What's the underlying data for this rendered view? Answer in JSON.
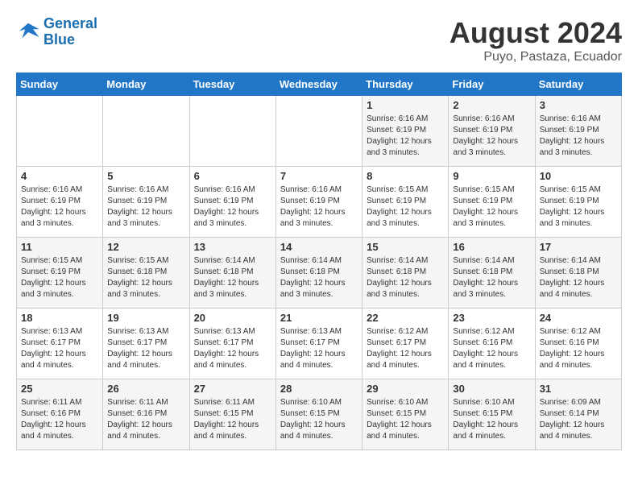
{
  "header": {
    "logo_line1": "General",
    "logo_line2": "Blue",
    "title": "August 2024",
    "subtitle": "Puyo, Pastaza, Ecuador"
  },
  "days_of_week": [
    "Sunday",
    "Monday",
    "Tuesday",
    "Wednesday",
    "Thursday",
    "Friday",
    "Saturday"
  ],
  "weeks": [
    [
      {
        "day": "",
        "info": ""
      },
      {
        "day": "",
        "info": ""
      },
      {
        "day": "",
        "info": ""
      },
      {
        "day": "",
        "info": ""
      },
      {
        "day": "1",
        "info": "Sunrise: 6:16 AM\nSunset: 6:19 PM\nDaylight: 12 hours\nand 3 minutes."
      },
      {
        "day": "2",
        "info": "Sunrise: 6:16 AM\nSunset: 6:19 PM\nDaylight: 12 hours\nand 3 minutes."
      },
      {
        "day": "3",
        "info": "Sunrise: 6:16 AM\nSunset: 6:19 PM\nDaylight: 12 hours\nand 3 minutes."
      }
    ],
    [
      {
        "day": "4",
        "info": "Sunrise: 6:16 AM\nSunset: 6:19 PM\nDaylight: 12 hours\nand 3 minutes."
      },
      {
        "day": "5",
        "info": "Sunrise: 6:16 AM\nSunset: 6:19 PM\nDaylight: 12 hours\nand 3 minutes."
      },
      {
        "day": "6",
        "info": "Sunrise: 6:16 AM\nSunset: 6:19 PM\nDaylight: 12 hours\nand 3 minutes."
      },
      {
        "day": "7",
        "info": "Sunrise: 6:16 AM\nSunset: 6:19 PM\nDaylight: 12 hours\nand 3 minutes."
      },
      {
        "day": "8",
        "info": "Sunrise: 6:15 AM\nSunset: 6:19 PM\nDaylight: 12 hours\nand 3 minutes."
      },
      {
        "day": "9",
        "info": "Sunrise: 6:15 AM\nSunset: 6:19 PM\nDaylight: 12 hours\nand 3 minutes."
      },
      {
        "day": "10",
        "info": "Sunrise: 6:15 AM\nSunset: 6:19 PM\nDaylight: 12 hours\nand 3 minutes."
      }
    ],
    [
      {
        "day": "11",
        "info": "Sunrise: 6:15 AM\nSunset: 6:19 PM\nDaylight: 12 hours\nand 3 minutes."
      },
      {
        "day": "12",
        "info": "Sunrise: 6:15 AM\nSunset: 6:18 PM\nDaylight: 12 hours\nand 3 minutes."
      },
      {
        "day": "13",
        "info": "Sunrise: 6:14 AM\nSunset: 6:18 PM\nDaylight: 12 hours\nand 3 minutes."
      },
      {
        "day": "14",
        "info": "Sunrise: 6:14 AM\nSunset: 6:18 PM\nDaylight: 12 hours\nand 3 minutes."
      },
      {
        "day": "15",
        "info": "Sunrise: 6:14 AM\nSunset: 6:18 PM\nDaylight: 12 hours\nand 3 minutes."
      },
      {
        "day": "16",
        "info": "Sunrise: 6:14 AM\nSunset: 6:18 PM\nDaylight: 12 hours\nand 3 minutes."
      },
      {
        "day": "17",
        "info": "Sunrise: 6:14 AM\nSunset: 6:18 PM\nDaylight: 12 hours\nand 4 minutes."
      }
    ],
    [
      {
        "day": "18",
        "info": "Sunrise: 6:13 AM\nSunset: 6:17 PM\nDaylight: 12 hours\nand 4 minutes."
      },
      {
        "day": "19",
        "info": "Sunrise: 6:13 AM\nSunset: 6:17 PM\nDaylight: 12 hours\nand 4 minutes."
      },
      {
        "day": "20",
        "info": "Sunrise: 6:13 AM\nSunset: 6:17 PM\nDaylight: 12 hours\nand 4 minutes."
      },
      {
        "day": "21",
        "info": "Sunrise: 6:13 AM\nSunset: 6:17 PM\nDaylight: 12 hours\nand 4 minutes."
      },
      {
        "day": "22",
        "info": "Sunrise: 6:12 AM\nSunset: 6:17 PM\nDaylight: 12 hours\nand 4 minutes."
      },
      {
        "day": "23",
        "info": "Sunrise: 6:12 AM\nSunset: 6:16 PM\nDaylight: 12 hours\nand 4 minutes."
      },
      {
        "day": "24",
        "info": "Sunrise: 6:12 AM\nSunset: 6:16 PM\nDaylight: 12 hours\nand 4 minutes."
      }
    ],
    [
      {
        "day": "25",
        "info": "Sunrise: 6:11 AM\nSunset: 6:16 PM\nDaylight: 12 hours\nand 4 minutes."
      },
      {
        "day": "26",
        "info": "Sunrise: 6:11 AM\nSunset: 6:16 PM\nDaylight: 12 hours\nand 4 minutes."
      },
      {
        "day": "27",
        "info": "Sunrise: 6:11 AM\nSunset: 6:15 PM\nDaylight: 12 hours\nand 4 minutes."
      },
      {
        "day": "28",
        "info": "Sunrise: 6:10 AM\nSunset: 6:15 PM\nDaylight: 12 hours\nand 4 minutes."
      },
      {
        "day": "29",
        "info": "Sunrise: 6:10 AM\nSunset: 6:15 PM\nDaylight: 12 hours\nand 4 minutes."
      },
      {
        "day": "30",
        "info": "Sunrise: 6:10 AM\nSunset: 6:15 PM\nDaylight: 12 hours\nand 4 minutes."
      },
      {
        "day": "31",
        "info": "Sunrise: 6:09 AM\nSunset: 6:14 PM\nDaylight: 12 hours\nand 4 minutes."
      }
    ]
  ]
}
